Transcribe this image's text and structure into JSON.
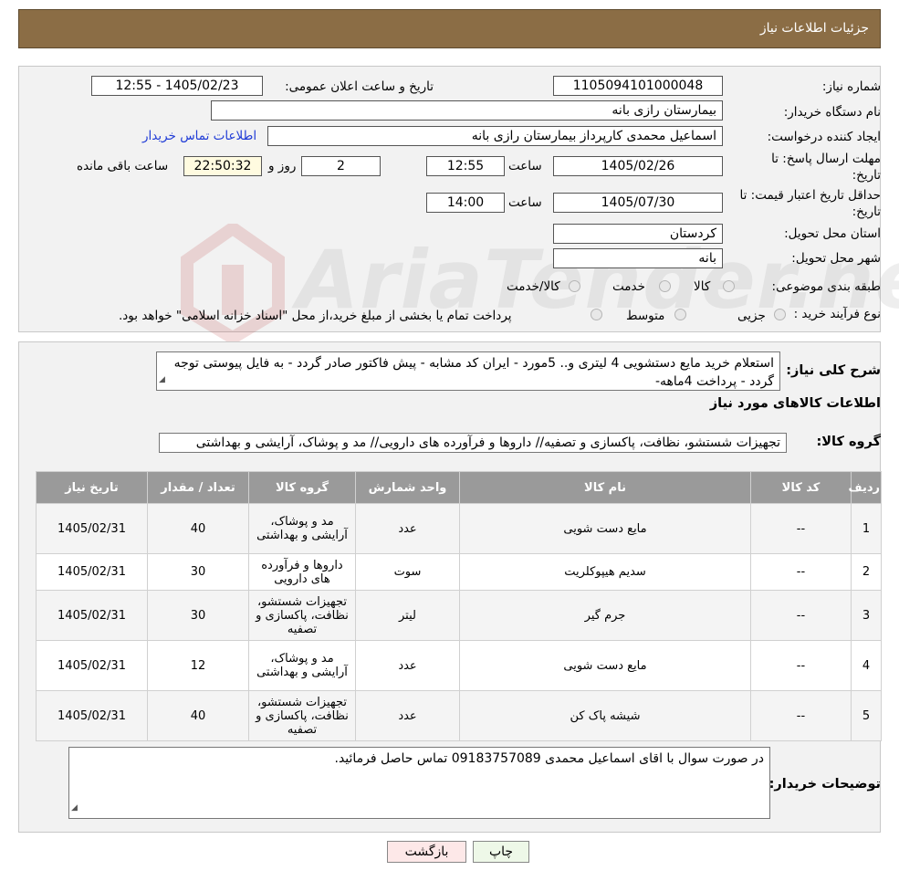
{
  "header": {
    "title": "جزئیات اطلاعات نیاز"
  },
  "fields": {
    "need_number_label": "شماره نیاز:",
    "need_number": "1105094101000048",
    "announce_label": "تاریخ و ساعت اعلان عمومی:",
    "announce_value": "1405/02/23 - 12:55",
    "buyer_org_label": "نام دستگاه خریدار:",
    "buyer_org": "بیمارستان رازی بانه",
    "requester_label": "ایجاد کننده درخواست:",
    "requester": "اسماعیل محمدی کارپرداز بیمارستان رازی بانه",
    "contact_link": "اطلاعات تماس خریدار",
    "deadline_label_1": "مهلت ارسال پاسخ: تا",
    "deadline_label_2": "تاریخ:",
    "deadline_date": "1405/02/26",
    "time_label": "ساعت",
    "deadline_time": "12:55",
    "days_value": "2",
    "days_label": "روز و",
    "remaining_value": "22:50:32",
    "remaining_label": "ساعت باقی مانده",
    "validity_label_1": "حداقل تاریخ اعتبار قیمت: تا",
    "validity_label_2": "تاریخ:",
    "validity_date": "1405/07/30",
    "validity_time": "14:00",
    "province_label": "استان محل تحویل:",
    "province": "کردستان",
    "city_label": "شهر محل تحویل:",
    "city": "بانه",
    "category_label": "طبقه بندی موضوعی:",
    "category_options": [
      "کالا",
      "خدمت",
      "کالا/خدمت"
    ],
    "process_label": "نوع فرآیند خرید :",
    "process_options": [
      "جزیی",
      "متوسط"
    ],
    "process_note": "پرداخت تمام یا بخشی از مبلغ خرید،از محل \"اسناد خزانه اسلامی\" خواهد بود."
  },
  "summary": {
    "label": "شرح کلی نیاز:",
    "text": "استعلام خرید  مایع دستشویی 4 لیتری و.. 5مورد - ایران کد مشابه - پیش فاکتور صادر گردد - به فایل پیوستی توجه گردد - پرداخت 4ماهه-",
    "goods_info_title": "اطلاعات کالاهای مورد نیاز",
    "goods_group_label": "گروه کالا:",
    "goods_group": "تجهیزات شستشو، نظافت، پاکسازی و تصفیه// داروها و فرآورده های دارویی// مد و پوشاک، آرایشی و بهداشتی"
  },
  "table": {
    "headers": [
      "ردیف",
      "کد کالا",
      "نام کالا",
      "واحد شمارش",
      "گروه کالا",
      "تعداد / مقدار",
      "تاریخ نیاز"
    ],
    "rows": [
      [
        "1",
        "--",
        "مایع دست شویی",
        "عدد",
        "مد و پوشاک، آرایشی و بهداشتی",
        "40",
        "1405/02/31"
      ],
      [
        "2",
        "--",
        "سدیم هیپوکلریت",
        "سوت",
        "داروها و فرآورده های دارویی",
        "30",
        "1405/02/31"
      ],
      [
        "3",
        "--",
        "جرم گیر",
        "لیتر",
        "تجهیزات شستشو، نظافت، پاکسازی و تصفیه",
        "30",
        "1405/02/31"
      ],
      [
        "4",
        "--",
        "مایع دست شویی",
        "عدد",
        "مد و پوشاک، آرایشی و بهداشتی",
        "12",
        "1405/02/31"
      ],
      [
        "5",
        "--",
        "شیشه پاک کن",
        "عدد",
        "تجهیزات شستشو، نظافت، پاکسازی و تصفیه",
        "40",
        "1405/02/31"
      ]
    ]
  },
  "buyer_notes": {
    "label": "توضیحات خریدار:",
    "text": "در صورت سوال با اقای اسماعیل محمدی 09183757089 تماس حاصل فرمائید."
  },
  "buttons": {
    "print": "چاپ",
    "back": "بازگشت"
  },
  "watermark": {
    "text": "AriaTender.neT"
  },
  "colors": {
    "header_bg": "#8b6d45",
    "table_header_bg": "#9a9a9a",
    "link": "#1f3bd6",
    "back_button_bg": "#fde8e8"
  }
}
